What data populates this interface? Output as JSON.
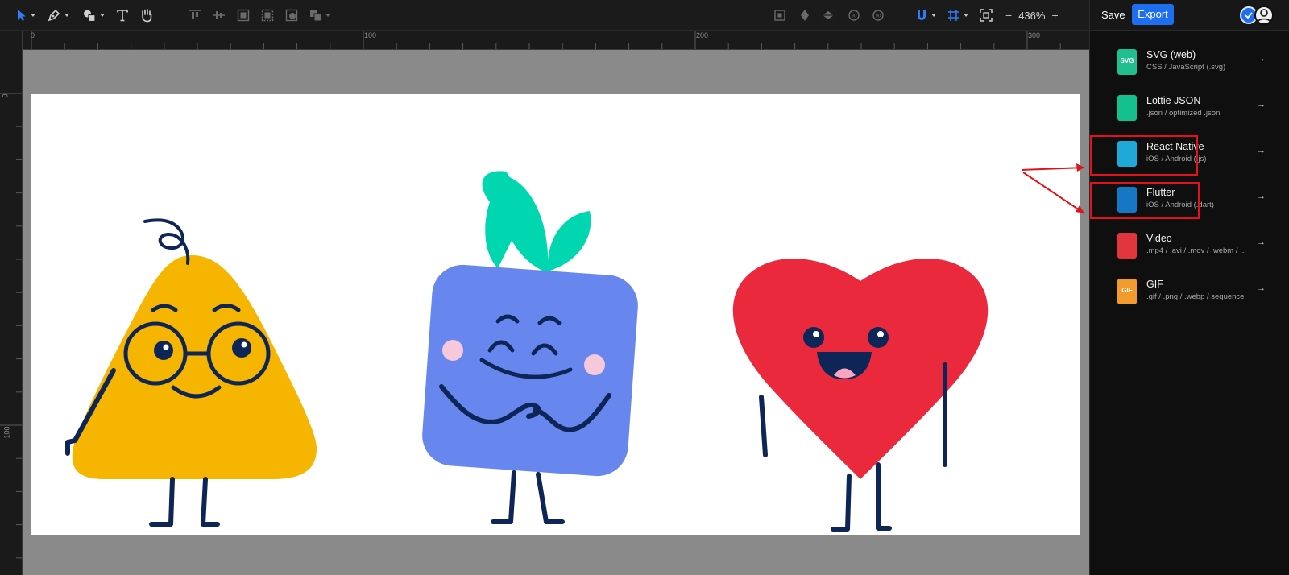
{
  "toolbar": {
    "tools": [
      "select-tool",
      "pen-tool",
      "shapes-tool",
      "text-tool",
      "hand-tool"
    ],
    "zoom": {
      "minus": "−",
      "value": "436%",
      "plus": "+"
    }
  },
  "rulers": {
    "top": [
      "0",
      "100",
      "200",
      "300"
    ],
    "left": [
      "0",
      "100"
    ]
  },
  "panel": {
    "save_label": "Save",
    "export_label": "Export",
    "export_options": [
      {
        "title": "SVG (web)",
        "sub": "CSS / JavaScript (.svg)",
        "icon": "svg-file-icon",
        "color": "#1fbf8f",
        "icon_text": "SVG"
      },
      {
        "title": "Lottie JSON",
        "sub": ".json / optimized .json",
        "icon": "lottie-file-icon",
        "color": "#14c08e",
        "icon_text": ""
      },
      {
        "title": "React Native",
        "sub": "iOS / Android (.js)",
        "icon": "react-file-icon",
        "color": "#1fa8d8",
        "icon_text": ""
      },
      {
        "title": "Flutter",
        "sub": "iOS / Android (.dart)",
        "icon": "flutter-file-icon",
        "color": "#1677c4",
        "icon_text": ""
      },
      {
        "title": "Video",
        "sub": ".mp4 / .avi / .mov / .webm / ...",
        "icon": "video-file-icon",
        "color": "#e0353c",
        "icon_text": ""
      },
      {
        "title": "GIF",
        "sub": ".gif / .png / .webp / sequence",
        "icon": "gif-file-icon",
        "color": "#f39a2c",
        "icon_text": "GIF"
      }
    ],
    "arrow": "→"
  },
  "colors": {
    "accent": "#1e6ef0",
    "highlight": "#e1121b",
    "pear": "#f6b500",
    "square": "#6787ee",
    "leaf": "#00d6b0",
    "heart": "#ea2a3c",
    "ink": "#0e2557",
    "blush": "#f6c8dc"
  }
}
